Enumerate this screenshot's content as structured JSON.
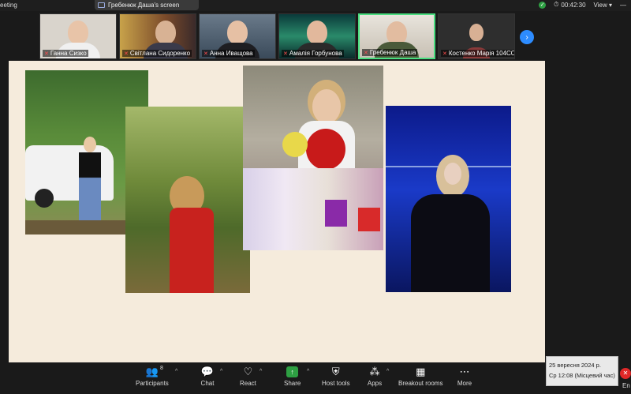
{
  "topbar": {
    "app_title": "eeting",
    "screen_share_label": "Гребенюк Даша's screen",
    "timer": "00:42:30",
    "view_label": "View"
  },
  "participants_gallery": [
    {
      "name": "Ганна Сизко",
      "muted": true
    },
    {
      "name": "Світлана Сидоренко",
      "muted": true
    },
    {
      "name": "Анна Иващова",
      "muted": true
    },
    {
      "name": "Амалія Горбунова",
      "muted": true
    },
    {
      "name": "Гребенюк Даша",
      "muted": true,
      "active": true
    },
    {
      "name": "Костенко Марія 104СО",
      "muted": true
    }
  ],
  "toolbar": {
    "participants_label": "Participants",
    "participants_count": "8",
    "chat_label": "Chat",
    "react_label": "React",
    "share_label": "Share",
    "host_tools_label": "Host tools",
    "apps_label": "Apps",
    "breakout_label": "Breakout rooms",
    "more_label": "More",
    "end_label": "En"
  },
  "system_clock": {
    "date": "25 вересня 2024 р.",
    "time": "Ср 12:08 (Місцевий час)"
  },
  "icons": {
    "security": "shield-check-icon",
    "participants": "people-icon",
    "chat": "chat-bubble-icon",
    "react": "heart-icon",
    "share": "share-arrow-icon",
    "host_tools": "shield-icon",
    "apps": "apps-icon",
    "breakout": "grid-icon",
    "more": "ellipsis-icon"
  },
  "colors": {
    "accent_blue": "#2d8cff",
    "active_border": "#4ade80",
    "share_green": "#2ea043",
    "end_red": "#e02828",
    "slide_bg": "#f5ebdc"
  }
}
